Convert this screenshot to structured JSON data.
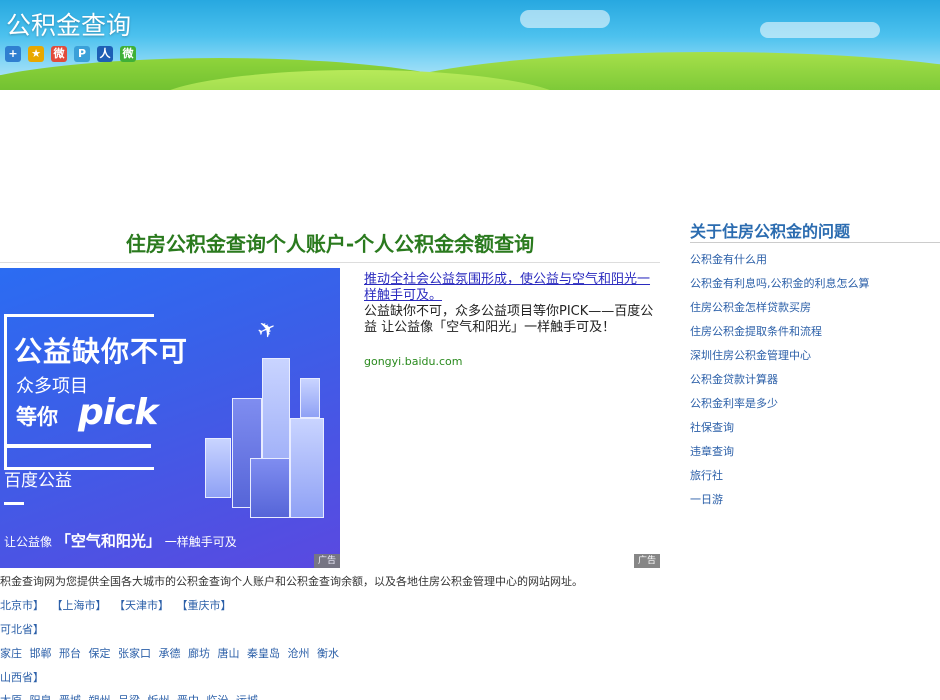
{
  "header": {
    "site_title": "公积金查询",
    "share_icons": [
      {
        "icon": "plus-share-icon",
        "glyph": "+",
        "color": "#2f7fd0"
      },
      {
        "icon": "qzone-star-icon",
        "glyph": "★",
        "color": "#e8a800"
      },
      {
        "icon": "weibo-icon",
        "glyph": "微",
        "color": "#e24b3b"
      },
      {
        "icon": "tencent-weibo-icon",
        "glyph": "P",
        "color": "#3aa0d8"
      },
      {
        "icon": "renren-icon",
        "glyph": "人",
        "color": "#1d5fb5"
      },
      {
        "icon": "wechat-icon",
        "glyph": "微",
        "color": "#3fb037"
      }
    ]
  },
  "article": {
    "title": "住房公积金查询个人账户-个人公积金余额查询"
  },
  "ad": {
    "image_headline": "公益缺你不可",
    "image_line2": "众多项目",
    "image_line3": "等你",
    "image_pick": "pick",
    "image_brand": "百度公益",
    "image_slogan_prefix": "让公益像",
    "image_slogan_bold": "「空气和阳光」",
    "image_slogan_suffix": "一样触手可及",
    "tag": "广告",
    "link_text": "推动全社会公益氛围形成，使公益与空气和阳光一样触手可及。",
    "description": "公益缺你不可，众多公益项目等你PICK——百度公益 让公益像「空气和阳光」一样触手可及！",
    "domain": "gongyi.baidu.com"
  },
  "content": {
    "intro": "积金查询网为您提供全国各大城市的公积金查询个人账户和公积金查询余额，以及各地住房公积金管理中心的网站网址。",
    "municipalities": [
      "北京市】",
      "【上海市】",
      "【天津市】",
      "【重庆市】"
    ],
    "province1": "可北省】",
    "province1_cities": [
      "家庄",
      "邯郸",
      "邢台",
      "保定",
      "张家口",
      "承德",
      "廊坊",
      "唐山",
      "秦皇岛",
      "沧州",
      "衡水"
    ],
    "province2": "山西省】",
    "province2_cities": [
      "太原",
      "阳泉",
      "晋城",
      "朔州",
      "吕梁",
      "忻州",
      "晋中",
      "临汾",
      "运城"
    ]
  },
  "sidebar": {
    "title": "关于住房公积金的问题",
    "items": [
      "公积金有什么用",
      "公积金有利息吗,公积金的利息怎么算",
      "住房公积金怎样贷款买房",
      "住房公积金提取条件和流程",
      "深圳住房公积金管理中心",
      "公积金贷款计算器",
      "公积金利率是多少",
      "社保查询",
      "违章查询",
      "旅行社",
      "一日游"
    ]
  }
}
